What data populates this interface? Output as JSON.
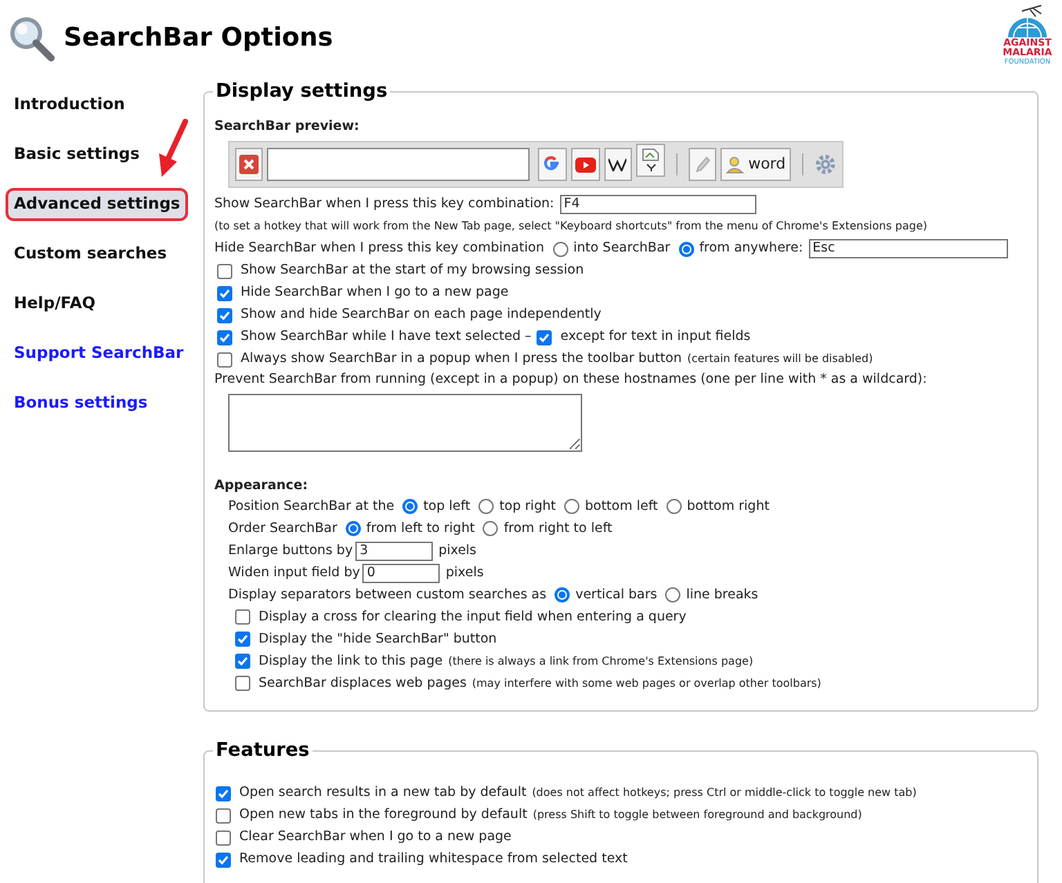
{
  "title": "SearchBar Options",
  "logo": {
    "lines": [
      "AGAINST",
      "MALARIA",
      "FOUNDATION"
    ]
  },
  "sidebar": {
    "items": [
      {
        "label": "Introduction",
        "selected": false,
        "kind": "internal"
      },
      {
        "label": "Basic settings",
        "selected": false,
        "kind": "internal"
      },
      {
        "label": "Advanced settings",
        "selected": true,
        "kind": "internal"
      },
      {
        "label": "Custom searches",
        "selected": false,
        "kind": "internal"
      },
      {
        "label": "Help/FAQ",
        "selected": false,
        "kind": "internal"
      },
      {
        "label": "Support SearchBar",
        "selected": false,
        "kind": "external"
      },
      {
        "label": "Bonus settings",
        "selected": false,
        "kind": "external"
      }
    ]
  },
  "display_settings": {
    "legend": "Display settings",
    "preview_label": "SearchBar preview:",
    "preview_word_button": "word",
    "rows": [
      {
        "kind": "input",
        "label": "Show SearchBar when I press this key combination:",
        "value": "F4"
      },
      {
        "kind": "note",
        "label": "(to set a hotkey that will work from the New Tab page, select \"Keyboard shortcuts\" from the menu of Chrome's Extensions page)"
      },
      {
        "kind": "radio",
        "label": "Hide SearchBar when I press this key combination",
        "options": [
          {
            "label": "into SearchBar",
            "selected": false
          },
          {
            "label": "from anywhere:",
            "selected": true
          }
        ],
        "value": "Esc"
      },
      {
        "kind": "checkbox",
        "label": "Show SearchBar at the start of my browsing session",
        "checked": false
      },
      {
        "kind": "checkbox",
        "label": "Hide SearchBar when I go to a new page",
        "checked": true
      },
      {
        "kind": "checkbox",
        "label": "Show and hide SearchBar on each page independently",
        "checked": true
      },
      {
        "kind": "checkbox",
        "label": "Show SearchBar while I have text selected –",
        "checked": true,
        "sub": {
          "label": "except for text in input fields",
          "checked": true
        }
      },
      {
        "kind": "checkbox",
        "label": "Always show SearchBar in a popup when I press the toolbar button",
        "checked": false,
        "note": "(certain features will be disabled)"
      },
      {
        "kind": "textarea",
        "label": "Prevent SearchBar from running (except in a popup) on these hostnames (one per line with * as a wildcard):"
      }
    ],
    "appearance": {
      "heading": "Appearance:",
      "rows": [
        {
          "kind": "radio",
          "label": "Position SearchBar at the",
          "options": [
            {
              "label": "top left",
              "selected": true
            },
            {
              "label": "top right",
              "selected": false
            },
            {
              "label": "bottom left",
              "selected": false
            },
            {
              "label": "bottom right",
              "selected": false
            }
          ]
        },
        {
          "kind": "radio",
          "label": "Order SearchBar",
          "options": [
            {
              "label": "from left to right",
              "selected": true
            },
            {
              "label": "from right to left",
              "selected": false
            }
          ]
        },
        {
          "kind": "input",
          "label": "Enlarge buttons by",
          "value": "3",
          "suffix": "pixels"
        },
        {
          "kind": "input",
          "label": "Widen input field by",
          "value": "0",
          "suffix": "pixels"
        },
        {
          "kind": "radio",
          "label": "Display separators between custom searches as",
          "options": [
            {
              "label": "vertical bars",
              "selected": true
            },
            {
              "label": "line breaks",
              "selected": false
            }
          ]
        },
        {
          "kind": "checkbox",
          "label": "Display a cross for clearing the input field when entering a query",
          "checked": false
        },
        {
          "kind": "checkbox",
          "label": "Display the \"hide SearchBar\" button",
          "checked": true
        },
        {
          "kind": "checkbox",
          "label": "Display the link to this page",
          "checked": true,
          "note": "(there is always a link from Chrome's Extensions page)"
        },
        {
          "kind": "checkbox",
          "label": "SearchBar displaces web pages",
          "checked": false,
          "note": "(may interfere with some web pages or overlap other toolbars)"
        }
      ]
    }
  },
  "features": {
    "legend": "Features",
    "rows": [
      {
        "kind": "checkbox",
        "label": "Open search results in a new tab by default",
        "checked": true,
        "note": "(does not affect hotkeys; press Ctrl or middle-click to toggle new tab)"
      },
      {
        "kind": "checkbox",
        "label": "Open new tabs in the foreground by default",
        "checked": false,
        "note": "(press Shift to toggle between foreground and background)"
      },
      {
        "kind": "checkbox",
        "label": "Clear SearchBar when I go to a new page",
        "checked": false
      },
      {
        "kind": "checkbox",
        "label": "Remove leading and trailing whitespace from selected text",
        "checked": true
      }
    ]
  }
}
